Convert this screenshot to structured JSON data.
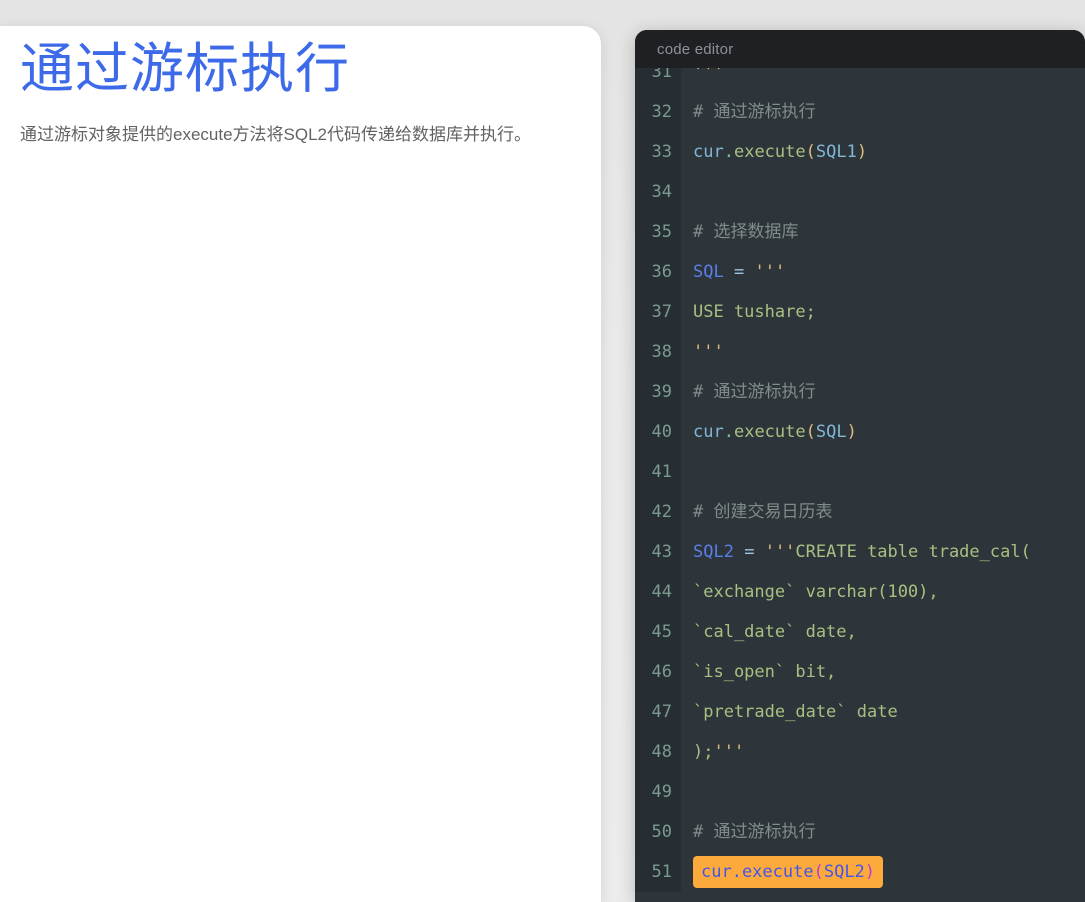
{
  "page": {
    "background_color": "#eaeaea"
  },
  "slide": {
    "title": "通过游标执行",
    "title_color": "#3d6ae8",
    "subtitle": "通过游标对象提供的execute方法将SQL2代码传递给数据库并执行。"
  },
  "editor": {
    "titlebar_label": "code editor",
    "background_color": "#2d353b",
    "gutter_color": "#272e33",
    "titlebar_color": "#1e2023",
    "highlight_color": "#fdaa3c",
    "lines": [
      {
        "number": "31",
        "tokens": [
          {
            "text": "'''",
            "type": "quote"
          }
        ]
      },
      {
        "number": "32",
        "tokens": [
          {
            "text": "# 通过游标执行",
            "type": "comment"
          }
        ]
      },
      {
        "number": "33",
        "tokens": [
          {
            "text": "cur",
            "type": "var2"
          },
          {
            "text": ".",
            "type": "dot"
          },
          {
            "text": "execute",
            "type": "fn"
          },
          {
            "text": "(",
            "type": "paren"
          },
          {
            "text": "SQL1",
            "type": "var2"
          },
          {
            "text": ")",
            "type": "paren"
          }
        ]
      },
      {
        "number": "34",
        "tokens": []
      },
      {
        "number": "35",
        "tokens": [
          {
            "text": "# 选择数据库",
            "type": "comment"
          }
        ]
      },
      {
        "number": "36",
        "tokens": [
          {
            "text": "SQL",
            "type": "var"
          },
          {
            "text": " ",
            "type": "punc"
          },
          {
            "text": "=",
            "type": "op"
          },
          {
            "text": " ",
            "type": "punc"
          },
          {
            "text": "'''",
            "type": "quote"
          }
        ]
      },
      {
        "number": "37",
        "tokens": [
          {
            "text": "USE tushare;",
            "type": "str"
          }
        ]
      },
      {
        "number": "38",
        "tokens": [
          {
            "text": "'''",
            "type": "quote"
          }
        ]
      },
      {
        "number": "39",
        "tokens": [
          {
            "text": "# 通过游标执行",
            "type": "comment"
          }
        ]
      },
      {
        "number": "40",
        "tokens": [
          {
            "text": "cur",
            "type": "var2"
          },
          {
            "text": ".",
            "type": "dot"
          },
          {
            "text": "execute",
            "type": "fn"
          },
          {
            "text": "(",
            "type": "paren"
          },
          {
            "text": "SQL",
            "type": "var2"
          },
          {
            "text": ")",
            "type": "paren"
          }
        ]
      },
      {
        "number": "41",
        "tokens": []
      },
      {
        "number": "42",
        "tokens": [
          {
            "text": "# 创建交易日历表",
            "type": "comment"
          }
        ]
      },
      {
        "number": "43",
        "tokens": [
          {
            "text": "SQL2",
            "type": "var"
          },
          {
            "text": " ",
            "type": "punc"
          },
          {
            "text": "=",
            "type": "op"
          },
          {
            "text": " ",
            "type": "punc"
          },
          {
            "text": "'''",
            "type": "quote"
          },
          {
            "text": "CREATE table trade_cal(",
            "type": "str"
          }
        ]
      },
      {
        "number": "44",
        "tokens": [
          {
            "text": "`exchange` varchar(100),",
            "type": "str"
          }
        ]
      },
      {
        "number": "45",
        "tokens": [
          {
            "text": "`cal_date` date,",
            "type": "str"
          }
        ]
      },
      {
        "number": "46",
        "tokens": [
          {
            "text": "`is_open` bit,",
            "type": "str"
          }
        ]
      },
      {
        "number": "47",
        "tokens": [
          {
            "text": "`pretrade_date` date",
            "type": "str"
          }
        ]
      },
      {
        "number": "48",
        "tokens": [
          {
            "text": ");",
            "type": "str"
          },
          {
            "text": "'''",
            "type": "quote"
          }
        ]
      },
      {
        "number": "49",
        "tokens": []
      },
      {
        "number": "50",
        "tokens": [
          {
            "text": "# 通过游标执行",
            "type": "comment"
          }
        ]
      },
      {
        "number": "51",
        "highlighted": true,
        "highlight_text": "cur.execute(SQL2)",
        "tokens": [
          {
            "text": "cur.execute(SQL2)",
            "type": "highlight"
          }
        ]
      }
    ]
  }
}
